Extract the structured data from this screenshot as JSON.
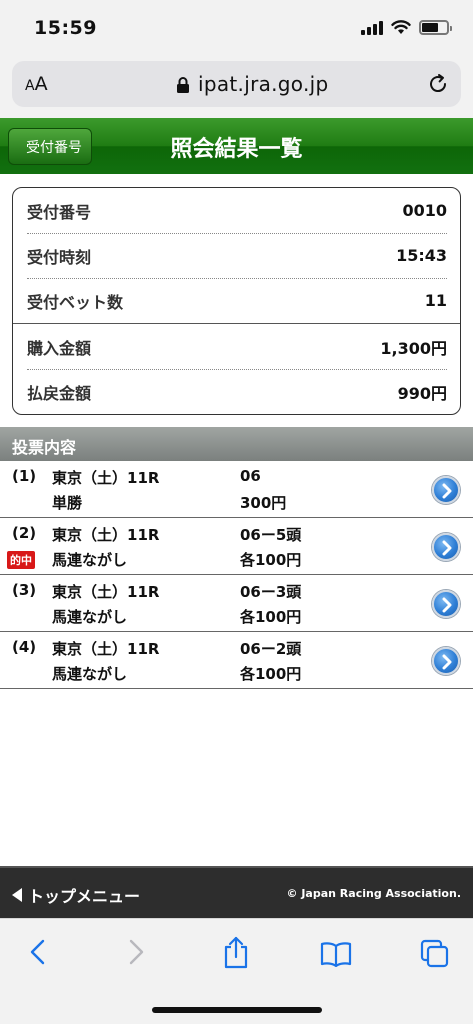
{
  "status_bar": {
    "time": "15:59",
    "battery_percent": 65
  },
  "address_bar": {
    "aa_small": "A",
    "aa_large": "A",
    "url": "ipat.jra.go.jp"
  },
  "header": {
    "back_label": "受付番号",
    "title": "照会結果一覧",
    "color": "#1f7c13"
  },
  "summary": {
    "rows": [
      {
        "label": "受付番号",
        "value": "0010"
      },
      {
        "label": "受付時刻",
        "value": "15:43"
      },
      {
        "label": "受付ベット数",
        "value": "11"
      },
      {
        "label": "購入金額",
        "value": "1,300円"
      },
      {
        "label": "払戻金額",
        "value": "990円"
      }
    ]
  },
  "section_title": "投票内容",
  "bets": [
    {
      "num": "(1)",
      "race": "東京（土）11R",
      "type": "単勝",
      "combo": "06",
      "amount": "300円",
      "hit": ""
    },
    {
      "num": "(2)",
      "race": "東京（土）11R",
      "type": "馬連ながし",
      "combo": "06ー5頭",
      "amount": "各100円",
      "hit": "的中"
    },
    {
      "num": "(3)",
      "race": "東京（土）11R",
      "type": "馬連ながし",
      "combo": "06ー3頭",
      "amount": "各100円",
      "hit": ""
    },
    {
      "num": "(4)",
      "race": "東京（土）11R",
      "type": "馬連ながし",
      "combo": "06ー2頭",
      "amount": "各100円",
      "hit": ""
    }
  ],
  "footer": {
    "top_menu": "トップメニュー",
    "copyright": "© Japan Racing Association."
  },
  "icons": [
    "signal-icon",
    "wifi-icon",
    "battery-icon",
    "lock-icon",
    "reload-icon",
    "chevron-right-icon",
    "back-icon",
    "forward-icon",
    "share-icon",
    "bookmarks-icon",
    "tabs-icon"
  ]
}
